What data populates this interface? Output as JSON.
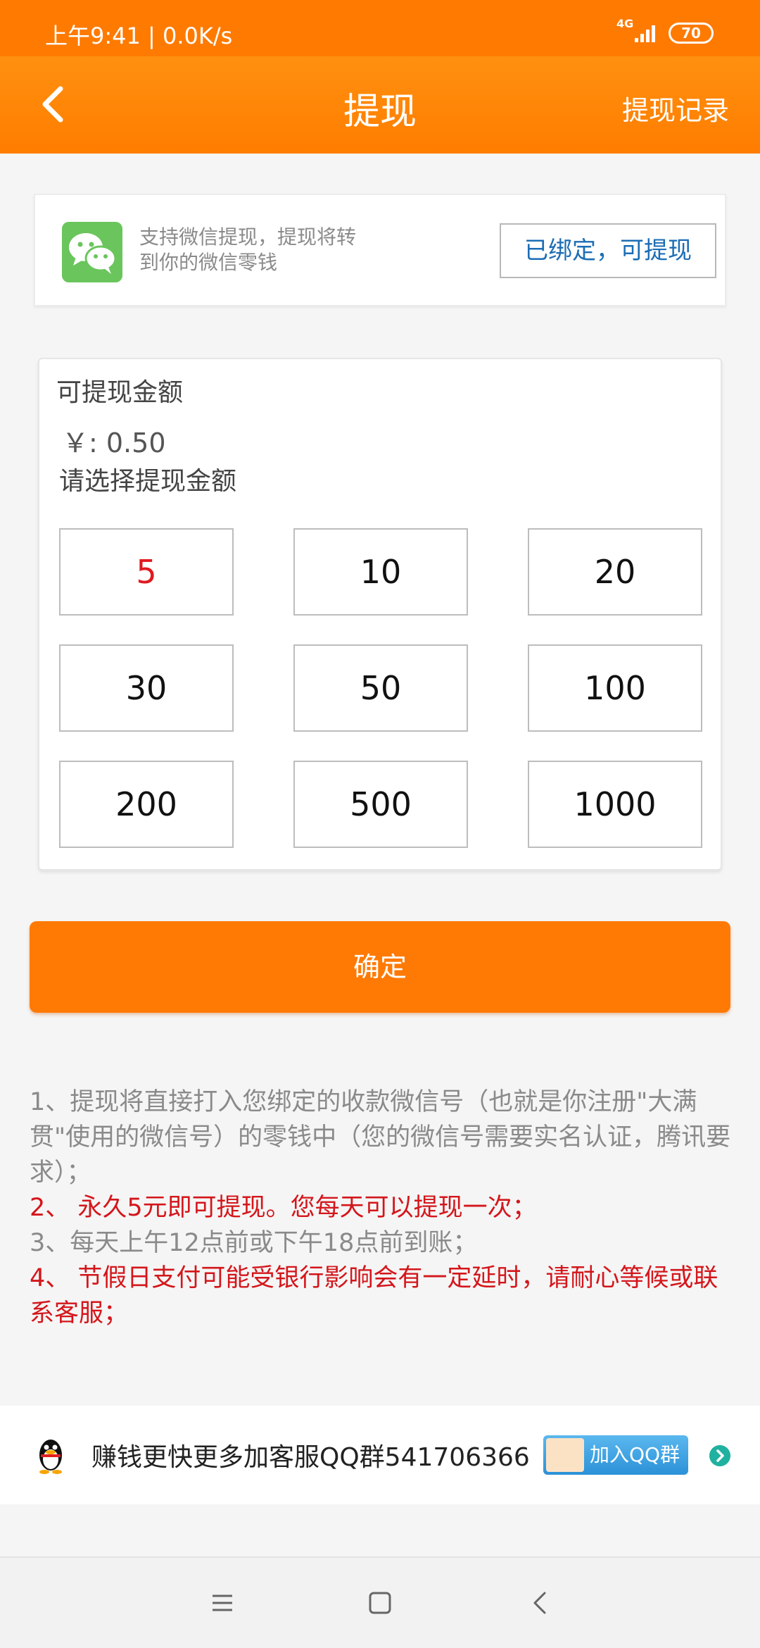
{
  "status": {
    "time": "上午9:41 | 0.0K/s",
    "network": "4G",
    "battery": "70"
  },
  "header": {
    "title": "提现",
    "record_link": "提现记录"
  },
  "wechat": {
    "description": "支持微信提现，提现将转到你的微信零钱",
    "bound_button": "已绑定，可提现"
  },
  "amount": {
    "label": "可提现金额",
    "value": "￥: 0.50",
    "choose_label": "请选择提现金额",
    "options": [
      "5",
      "10",
      "20",
      "30",
      "50",
      "100",
      "200",
      "500",
      "1000"
    ],
    "selected": "5"
  },
  "confirm_label": "确定",
  "notes": [
    "1、提现将直接打入您绑定的收款微信号（也就是你注册\"大满贯\"使用的微信号）的零钱中（您的微信号需要实名认证，腾讯要求）；",
    "2、 永久5元即可提现。您每天可以提现一次；",
    "3、每天上午12点前或下午18点前到账；",
    "4、 节假日支付可能受银行影响会有一定延时，请耐心等候或联系客服；"
  ],
  "qq": {
    "text": "赚钱更快更多加客服QQ群541706366",
    "join_label": "加入QQ群"
  },
  "colors": {
    "brand_orange": "#ff7a00",
    "selected_red": "#e0191f",
    "note_red": "#d4161b",
    "link_blue": "#1c6db5",
    "wechat_green": "#6ac55c"
  }
}
